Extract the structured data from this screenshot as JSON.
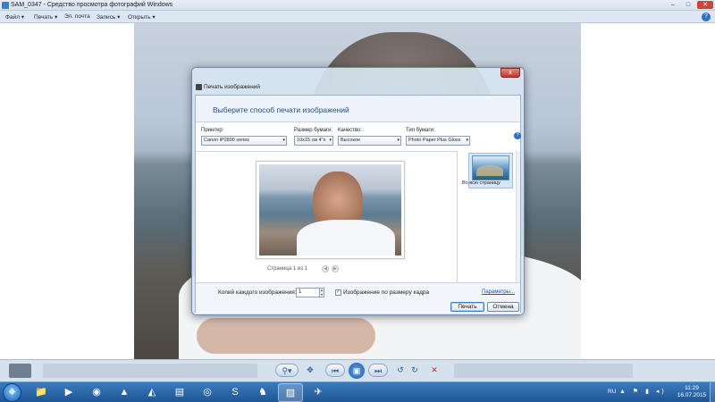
{
  "window": {
    "title": "SAM_0347 - Средство просмотра фотографий Windows",
    "min": "–",
    "max": "□",
    "close": "✕"
  },
  "menu": {
    "items": [
      "Файл ▾",
      "Печать ▾",
      "Эл. почта",
      "Запись ▾",
      "Открыть ▾"
    ],
    "help": "?"
  },
  "viewer_controls": {
    "zoom": "⚲▾",
    "fit": "✥",
    "prev": "⏮",
    "slideshow": "▣",
    "next": "⏭",
    "rotate_left": "↺",
    "rotate_right": "↻",
    "delete": "✕"
  },
  "dialog": {
    "title": "Печать изображений",
    "close": "x",
    "heading": "Выберите способ печати изображений",
    "help": "?",
    "printer_label": "Принтер:",
    "printer_value": "Canon iP2800 series",
    "paper_size_label": "Размер бумаги:",
    "paper_size_value": "10x15 см 4\"x",
    "quality_label": "Качество:",
    "quality_value": "Высокое",
    "paper_type_label": "Тип бумаги:",
    "paper_type_value": "Photo Paper Plus Gloss",
    "dropdown_arrow": "▾",
    "pager": "Страница 1 из 1",
    "prev_page": "◀",
    "next_page": "▶",
    "layout_label": "Во всю страницу",
    "copies_label": "Копий каждого изображения:",
    "copies_value": "1",
    "spin_up": "▲",
    "spin_down": "▼",
    "fit_check": "✓",
    "fit_label": "Изображение по размеру кадра",
    "params_link": "Параметры...",
    "print_button": "Печать",
    "cancel_button": "Отмена"
  },
  "taskbar": {
    "start": "❖",
    "items": [
      {
        "name": "explorer-icon",
        "glyph": "📁"
      },
      {
        "name": "media-player-icon",
        "glyph": "▶"
      },
      {
        "name": "chrome-icon",
        "glyph": "◉"
      },
      {
        "name": "aimp-icon",
        "glyph": "▲"
      },
      {
        "name": "vlc-icon",
        "glyph": "◭"
      },
      {
        "name": "document-icon",
        "glyph": "▤"
      },
      {
        "name": "disc-icon",
        "glyph": "◎"
      },
      {
        "name": "skype-icon",
        "glyph": "S"
      },
      {
        "name": "game-icon",
        "glyph": "♞"
      },
      {
        "name": "photo-viewer-icon",
        "glyph": "▨"
      },
      {
        "name": "airplane-icon",
        "glyph": "✈"
      }
    ],
    "lang": "RU",
    "tray": "▲ ⚑ ▮ ◂)",
    "time": "11:29",
    "date": "16.07.2015"
  }
}
